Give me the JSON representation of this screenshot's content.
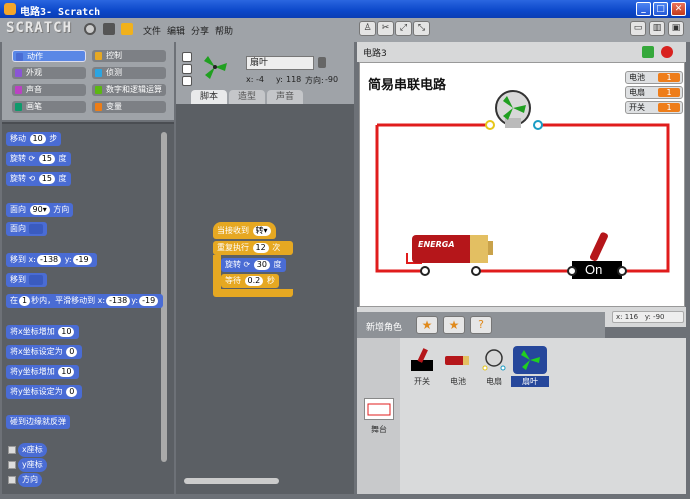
{
  "window": {
    "title": "电路3- Scratch",
    "min_label": "_",
    "max_label": "□",
    "close_label": "✕"
  },
  "menubar": {
    "logo": "SCRATCH",
    "file": "文件",
    "edit": "编辑",
    "share": "分享",
    "help": "帮助"
  },
  "categories": [
    {
      "label": "动作",
      "color": "#4a6cd4",
      "selected": true
    },
    {
      "label": "控制",
      "color": "#e6a822",
      "selected": false
    },
    {
      "label": "外观",
      "color": "#8a55d7",
      "selected": false
    },
    {
      "label": "侦测",
      "color": "#2ca5e2",
      "selected": false
    },
    {
      "label": "声音",
      "color": "#bb42c3",
      "selected": false
    },
    {
      "label": "数字和逻辑运算",
      "color": "#5cb712",
      "selected": false
    },
    {
      "label": "画笔",
      "color": "#0e9a6c",
      "selected": false
    },
    {
      "label": "变量",
      "color": "#ee7d16",
      "selected": false
    }
  ],
  "palette": {
    "move": {
      "a": "移动",
      "v": "10",
      "b": "步"
    },
    "turn_right": {
      "a": "旋转",
      "icon": "⟳",
      "v": "15",
      "b": "度"
    },
    "turn_left": {
      "a": "旋转",
      "icon": "⟲",
      "v": "15",
      "b": "度"
    },
    "point_dir": {
      "a": "面向",
      "v": "90▾",
      "b": "方向"
    },
    "point_towards": {
      "a": "面向"
    },
    "goto_xy": {
      "a": "移到 x:",
      "x": "-138",
      "b": "y:",
      "y": "-19"
    },
    "goto": {
      "a": "移到"
    },
    "glide": {
      "a": "在",
      "t": "1",
      "b": "秒内，平滑移动到 x:",
      "x": "-138",
      "c": "y:",
      "y": "-19"
    },
    "change_x": {
      "a": "将x坐标增加",
      "v": "10"
    },
    "set_x": {
      "a": "将x坐标设定为",
      "v": "0"
    },
    "change_y": {
      "a": "将y坐标增加",
      "v": "10"
    },
    "set_y": {
      "a": "将y坐标设定为",
      "v": "0"
    },
    "bounce": "碰到边缘就反弹",
    "xpos": "x座标",
    "ypos": "y座标",
    "direction": "方向"
  },
  "sprite": {
    "name": "扇叶",
    "x_label": "x:",
    "x": "-4",
    "y_label": "y:",
    "y": "118",
    "dir_label": "方向:",
    "dir": "-90"
  },
  "tabs": {
    "scripts": "脚本",
    "costumes": "造型",
    "sounds": "声音"
  },
  "script": {
    "hat": {
      "a": "当接收到",
      "v": "转▾"
    },
    "repeat": {
      "a": "重复执行",
      "v": "12",
      "b": "次"
    },
    "turn": {
      "a": "旋转",
      "icon": "⟳",
      "v": "30",
      "b": "度"
    },
    "wait": {
      "a": "等待",
      "v": "0.2",
      "b": "秒"
    }
  },
  "stage": {
    "title": "电路3",
    "heading": "简易串联电路",
    "battery_text": "ENERGA",
    "switch_text": "On",
    "monitors": [
      {
        "label": "电池",
        "value": "1"
      },
      {
        "label": "电扇",
        "value": "1"
      },
      {
        "label": "开关",
        "value": "1"
      }
    ],
    "mouse_x_label": "x:",
    "mouse_x": "116",
    "mouse_y_label": "y:",
    "mouse_y": "-90"
  },
  "sprites_panel": {
    "new_sprite": "新增角色",
    "sprites": [
      {
        "label": "开关",
        "selected": false
      },
      {
        "label": "电池",
        "selected": false
      },
      {
        "label": "电扇",
        "selected": false
      },
      {
        "label": "扇叶",
        "selected": true
      }
    ],
    "stage_label": "舞台"
  }
}
